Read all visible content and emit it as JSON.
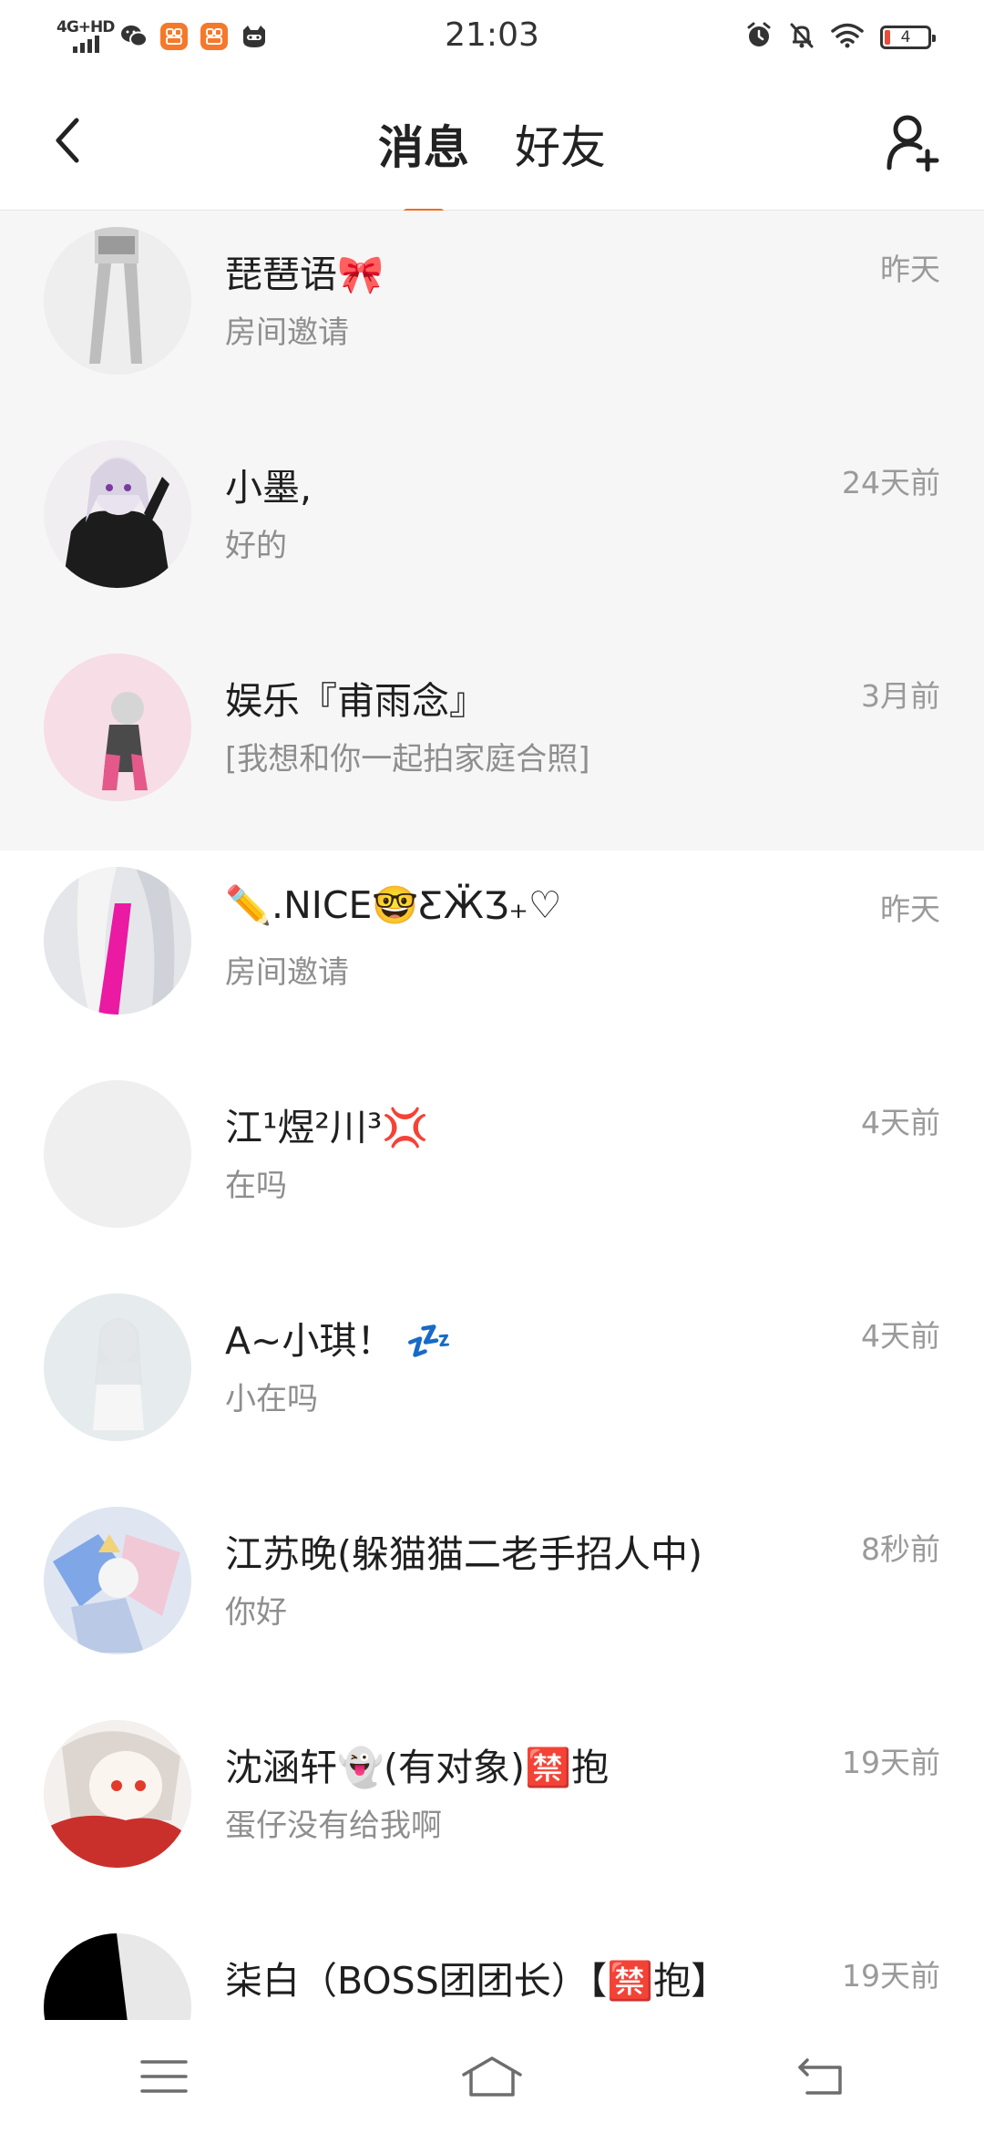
{
  "status_bar": {
    "time": "21:03",
    "network": "4G+HD",
    "battery": "4"
  },
  "header": {
    "tabs": [
      {
        "label": "消息",
        "active": true
      },
      {
        "label": "好友",
        "active": false
      }
    ],
    "accent_color": "#f26b1d"
  },
  "messages": [
    {
      "name": "琵琶语🎀",
      "preview": "房间邀请",
      "time": "昨天"
    },
    {
      "name": "小墨,",
      "preview": "好的",
      "time": "24天前"
    },
    {
      "name": "娱乐『甫雨念』",
      "preview": "[我想和你一起拍家庭合照]",
      "time": "3月前"
    },
    {
      "name": "✏️.NICE🤓ƸӜƷ₊♡",
      "preview": "房间邀请",
      "time": "昨天"
    },
    {
      "name": "江¹煜²川³💢",
      "preview": "在吗",
      "time": "4天前"
    },
    {
      "name": "A~小琪！ 💤",
      "preview": "小在吗",
      "time": "4天前"
    },
    {
      "name": "江苏晚(躲猫猫二老手招人中)",
      "preview": "你好",
      "time": "8秒前"
    },
    {
      "name": "沈涵轩👻(有对象)🈲抱",
      "preview": "蛋仔没有给我啊",
      "time": "19天前"
    },
    {
      "name": "柒白（BOSS团团长）【🈲抱】",
      "preview": "",
      "time": "19天前"
    }
  ]
}
